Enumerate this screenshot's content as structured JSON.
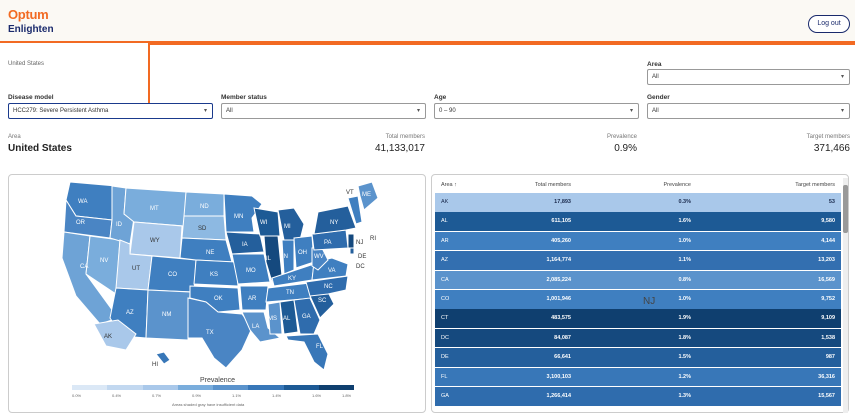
{
  "header": {
    "logo": "Optum",
    "app_name": "Enlighten",
    "logout_label": "Log out"
  },
  "breadcrumb": "United States",
  "filters": {
    "area": {
      "label": "Area",
      "value": "All"
    },
    "disease_model": {
      "label": "Disease model",
      "value": "HCC279: Severe Persistent Asthma"
    },
    "member_status": {
      "label": "Member status",
      "value": "All"
    },
    "age": {
      "label": "Age",
      "value": "0 – 90"
    },
    "gender": {
      "label": "Gender",
      "value": "All"
    }
  },
  "summary": {
    "area_label": "Area",
    "area_value": "United States",
    "total_label": "Total members",
    "total_value": "41,133,017",
    "prev_label": "Prevalence",
    "prev_value": "0.9%",
    "target_label": "Target members",
    "target_value": "371,466"
  },
  "map": {
    "legend_title": "Prevalence",
    "legend_ticks": [
      "0.0%",
      "0.4%",
      "0.7%",
      "0.9%",
      "1.1%",
      "1.4%",
      "1.6%",
      "1.8%"
    ],
    "legend_note": "Areas shaded gray have insufficient data",
    "state_labels": [
      "WA",
      "OR",
      "CA",
      "NV",
      "ID",
      "MT",
      "WY",
      "UT",
      "AZ",
      "CO",
      "NM",
      "ND",
      "SD",
      "NE",
      "KS",
      "OK",
      "TX",
      "MN",
      "IA",
      "MO",
      "AR",
      "LA",
      "WI",
      "IL",
      "MI",
      "IN",
      "OH",
      "KY",
      "TN",
      "MS",
      "AL",
      "GA",
      "FL",
      "SC",
      "NC",
      "VA",
      "WV",
      "PA",
      "NY",
      "VT",
      "ME",
      "AK",
      "HI",
      "NJ",
      "DE",
      "DC",
      "RI"
    ],
    "floating_label": "NJ"
  },
  "table": {
    "headers": [
      "Area",
      "Total members",
      "Prevalence",
      "Target members"
    ],
    "sort_icon": "arrow-up-icon",
    "rows": [
      [
        "AK",
        "17,893",
        "0.3%",
        "53"
      ],
      [
        "AL",
        "611,105",
        "1.6%",
        "9,580"
      ],
      [
        "AR",
        "405,260",
        "1.0%",
        "4,144"
      ],
      [
        "AZ",
        "1,164,774",
        "1.1%",
        "13,203"
      ],
      [
        "CA",
        "2,085,224",
        "0.8%",
        "16,569"
      ],
      [
        "CO",
        "1,001,946",
        "1.0%",
        "9,752"
      ],
      [
        "CT",
        "483,575",
        "1.9%",
        "9,109"
      ],
      [
        "DC",
        "84,087",
        "1.8%",
        "1,538"
      ],
      [
        "DE",
        "66,641",
        "1.5%",
        "987"
      ],
      [
        "FL",
        "3,100,103",
        "1.2%",
        "36,316"
      ],
      [
        "GA",
        "1,266,414",
        "1.3%",
        "15,567"
      ]
    ],
    "row_colors": [
      "#a9c8ea",
      "#1d5a95",
      "#3f7fc0",
      "#336fb0",
      "#5b93cc",
      "#3f7fc0",
      "#0f3f6f",
      "#15497e",
      "#245f9c",
      "#3877b8",
      "#2f6cad"
    ]
  }
}
